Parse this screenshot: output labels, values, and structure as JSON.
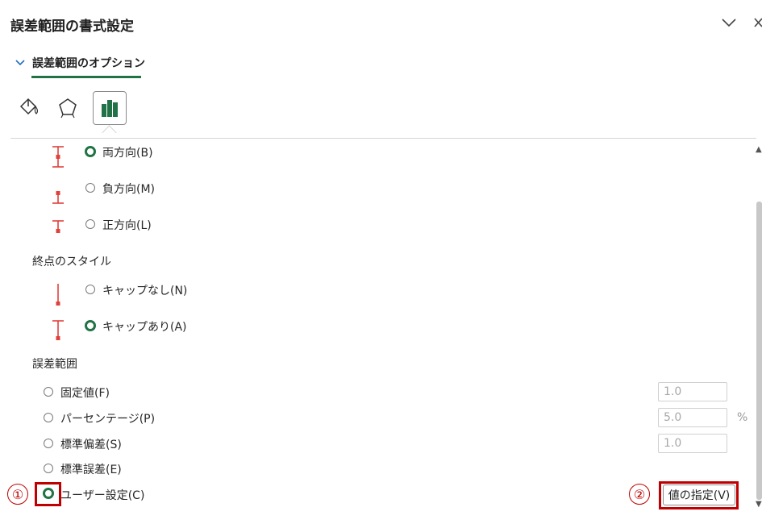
{
  "pane": {
    "title": "誤差範囲の書式設定",
    "section_label": "誤差範囲のオプション"
  },
  "direction": {
    "options": [
      {
        "label": "両方向(B)",
        "checked": true
      },
      {
        "label": "負方向(M)",
        "checked": false
      },
      {
        "label": "正方向(L)",
        "checked": false
      }
    ]
  },
  "end_style": {
    "heading": "終点のスタイル",
    "options": [
      {
        "label": "キャップなし(N)",
        "checked": false
      },
      {
        "label": "キャップあり(A)",
        "checked": true
      }
    ]
  },
  "error_amount": {
    "heading": "誤差範囲",
    "options": [
      {
        "label": "固定値(F)",
        "checked": false,
        "value": "1.0"
      },
      {
        "label": "パーセンテージ(P)",
        "checked": false,
        "value": "5.0",
        "unit": "%"
      },
      {
        "label": "標準偏差(S)",
        "checked": false,
        "value": "1.0"
      },
      {
        "label": "標準誤差(E)",
        "checked": false
      },
      {
        "label": "ユーザー設定(C)",
        "checked": true
      }
    ],
    "specify_button": "値の指定(V)"
  },
  "annotations": {
    "marker_1": "①",
    "marker_2": "②",
    "color": "#c00000"
  },
  "colors": {
    "accent": "#217346",
    "errorbar": "#e0403a"
  },
  "icons": {
    "collapse": "chevron-down-icon",
    "close": "close-icon",
    "tab1": "fill-line-icon",
    "tab2": "effects-pentagon-icon",
    "tab3": "bar-chart-options-icon"
  }
}
